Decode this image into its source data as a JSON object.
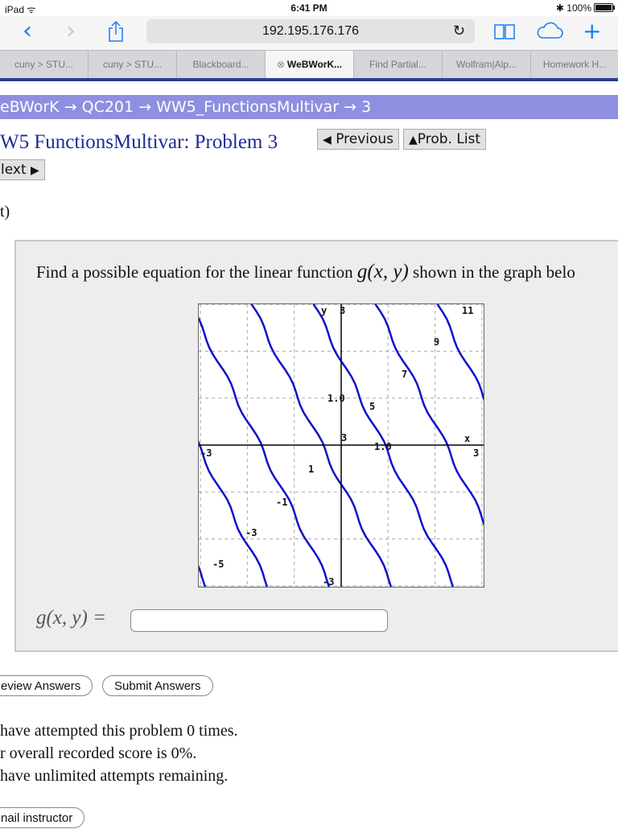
{
  "status": {
    "device": "iPad",
    "wifi": "ᯤ",
    "time": "6:41 PM",
    "bluetooth": "✱",
    "battery": "100%"
  },
  "toolbar": {
    "back": "‹",
    "forward": "›",
    "url": "192.195.176.176",
    "reload": "↻",
    "plus": "+"
  },
  "tabs": [
    {
      "label": "cuny > STU..."
    },
    {
      "label": "cuny > STU..."
    },
    {
      "label": "Blackboard..."
    },
    {
      "label": "WeBWorK..."
    },
    {
      "label": "Find Partial..."
    },
    {
      "label": "Wolfram|Alp..."
    },
    {
      "label": "Homework H..."
    }
  ],
  "breadcrumb": "eBWorK → QC201 → WW5_FunctionsMultivar → 3",
  "title": "W5 FunctionsMultivar: Problem 3",
  "nav": {
    "previous": "Previous",
    "prob_list": "Prob. List",
    "next": "lext"
  },
  "points": "t)",
  "question": {
    "before": "Find a possible equation for the linear function ",
    "math": "g(x, y)",
    "after": " shown in the graph belo"
  },
  "graph_labels": {
    "y_axis": "y",
    "y_top": "3",
    "x_axis": "x",
    "x_right": "3",
    "x_left": "-3",
    "y_bottom": "-3",
    "x_tick": "1.0",
    "y_tick": "1.0",
    "contours": [
      "11",
      "9",
      "7",
      "5",
      "3",
      "1",
      "-1",
      "-3",
      "-5"
    ]
  },
  "answer": {
    "label": "g(x, y) =",
    "value": ""
  },
  "buttons": {
    "preview": "eview Answers",
    "submit": "Submit Answers",
    "email": "nail instructor"
  },
  "info": {
    "line1": " have attempted this problem 0 times.",
    "line2": "r overall recorded score is 0%.",
    "line3": " have unlimited attempts remaining."
  }
}
